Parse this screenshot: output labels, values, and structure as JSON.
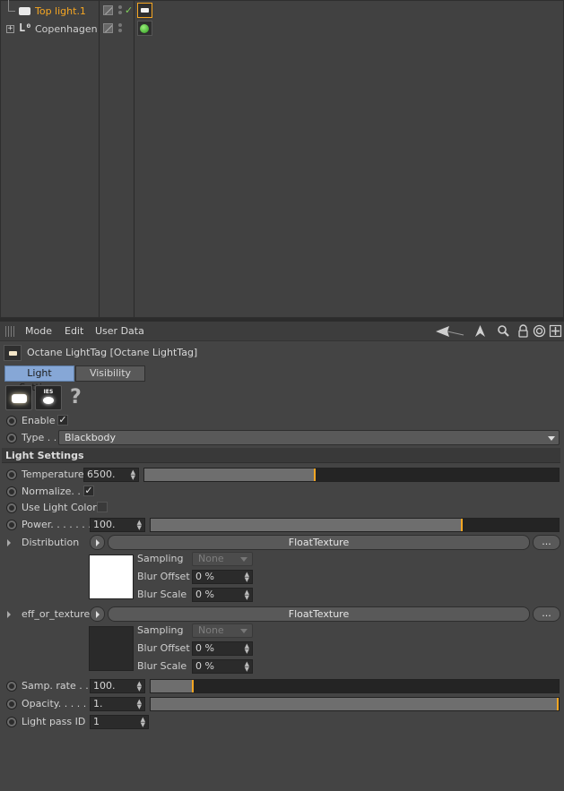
{
  "object_manager": {
    "objects": [
      {
        "name": "Top light.1",
        "selected": true,
        "icon": "light-object-icon",
        "tag_icon": "octane-light-tag-icon"
      },
      {
        "name": "Copenhagen",
        "selected": false,
        "icon": "null-object-icon",
        "tag_icon": "octane-material-tag-icon"
      }
    ]
  },
  "attribute_manager": {
    "menu": [
      "Mode",
      "Edit",
      "User Data"
    ],
    "toolbar_icons": [
      "back-arrow-icon",
      "up-arrow-icon",
      "search-icon",
      "lock-icon",
      "target-icon",
      "new-panel-icon"
    ],
    "tag_title": "Octane LightTag [Octane LightTag]",
    "tabs": [
      "Light Settings",
      "Visibility"
    ],
    "active_tab": "Light Settings",
    "light_type_icons": [
      "area-light-icon",
      "ies-light-icon"
    ],
    "ies_label": "IES",
    "help_glyph": "?",
    "enable": {
      "label": "Enable",
      "checked": true
    },
    "type": {
      "label": "Type . .",
      "value": "Blackbody"
    },
    "section_title": "Light Settings",
    "temperature": {
      "label": "Temperature",
      "value": "6500.",
      "slider_fraction": 0.41
    },
    "normalize": {
      "label": "Normalize. .",
      "checked": true
    },
    "use_light_color": {
      "label": "Use Light Color",
      "checked": false
    },
    "power": {
      "label": "Power. . . . . . .",
      "value": "100.",
      "slider_fraction": 0.76
    },
    "distribution": {
      "label": "Distribution",
      "texture": "FloatTexture",
      "more": "...",
      "preview_color": "#ffffff",
      "sampling": {
        "label": "Sampling",
        "value": "None"
      },
      "blur_offset": {
        "label": "Blur Offset",
        "value": "0 %"
      },
      "blur_scale": {
        "label": "Blur Scale",
        "value": "0 %"
      }
    },
    "eff_or_texture": {
      "label": "eff_or_texture",
      "texture": "FloatTexture",
      "more": "...",
      "preview_color": "#2a2a2a",
      "sampling": {
        "label": "Sampling",
        "value": "None"
      },
      "blur_offset": {
        "label": "Blur Offset",
        "value": "0 %"
      },
      "blur_scale": {
        "label": "Blur Scale",
        "value": "0 %"
      }
    },
    "samp_rate": {
      "label": "Samp. rate . . .",
      "value": "100.",
      "slider_fraction": 0.1
    },
    "opacity": {
      "label": "Opacity. . . . . .",
      "value": "1.",
      "slider_fraction": 1.0
    },
    "light_pass_id": {
      "label": "Light pass ID",
      "value": "1"
    }
  },
  "colors": {
    "accent": "#f5a623",
    "active_tab": "#86a7d6",
    "panel_bg": "#444444"
  }
}
